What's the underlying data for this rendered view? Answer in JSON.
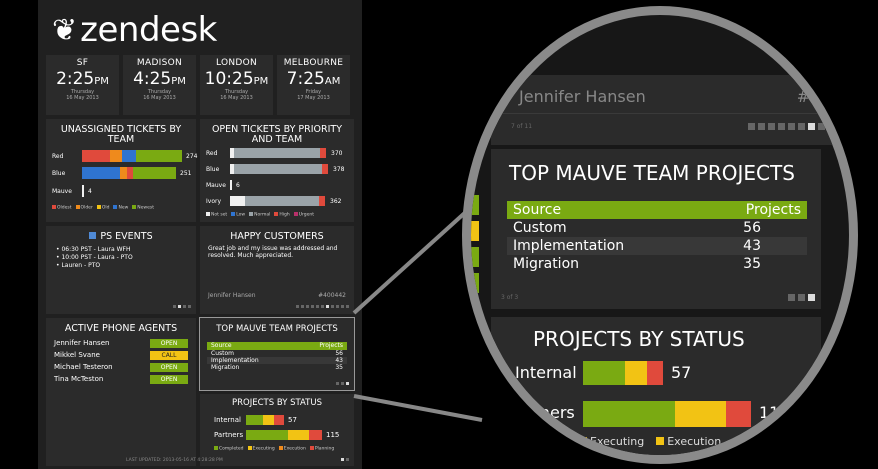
{
  "brand": {
    "name": "zendesk"
  },
  "clocks": [
    {
      "city": "SF",
      "time": "2:25",
      "ampm": "PM",
      "day": "Thursday",
      "date": "16 May 2013"
    },
    {
      "city": "MADISON",
      "time": "4:25",
      "ampm": "PM",
      "day": "Thursday",
      "date": "16 May 2013"
    },
    {
      "city": "LONDON",
      "time": "10:25",
      "ampm": "PM",
      "day": "Thursday",
      "date": "16 May 2013"
    },
    {
      "city": "MELBOURNE",
      "time": "7:25",
      "ampm": "AM",
      "day": "Friday",
      "date": "17 May 2013"
    }
  ],
  "unassigned": {
    "title": "UNASSIGNED TICKETS BY TEAM",
    "rows": [
      {
        "label": "Red",
        "value": "274"
      },
      {
        "label": "Blue",
        "value": "251"
      },
      {
        "label": "Mauve",
        "value": "4"
      }
    ],
    "legend": [
      "Oldest",
      "Older",
      "Old",
      "New",
      "Newest"
    ]
  },
  "open_priority": {
    "title": "OPEN TICKETS BY PRIORITY AND TEAM",
    "rows": [
      {
        "label": "Red",
        "value": "370"
      },
      {
        "label": "Blue",
        "value": "378"
      },
      {
        "label": "Mauve",
        "value": "6"
      },
      {
        "label": "Ivory",
        "value": "362"
      }
    ],
    "legend": [
      "Not set",
      "Low",
      "Normal",
      "High",
      "Urgent"
    ]
  },
  "ps_events": {
    "title": "PS EVENTS",
    "items": [
      "06:30 PST - Laura WFH",
      "10:00 PST - Laura - PTO",
      "Lauren - PTO"
    ]
  },
  "happy": {
    "title": "HAPPY CUSTOMERS",
    "quote": "Great job and my issue was addressed and resolved. Much appreciated.",
    "customer": "Jennifer Hansen",
    "ticket": "#400442"
  },
  "phone_agents": {
    "title": "ACTIVE PHONE AGENTS",
    "agents": [
      {
        "name": "Jennifer Hansen",
        "status": "OPEN"
      },
      {
        "name": "Mikkel Svane",
        "status": "CALL"
      },
      {
        "name": "Michael Testeron",
        "status": "OPEN"
      },
      {
        "name": "Tina McTeston",
        "status": "OPEN"
      }
    ],
    "updated": "LAST UPDATED: 2013-05-16 AT 4:28:28 PM"
  },
  "mauve_projects": {
    "title": "TOP MAUVE TEAM PROJECTS",
    "headers": [
      "Source",
      "Projects"
    ],
    "rows": [
      {
        "source": "Custom",
        "projects": "56"
      },
      {
        "source": "Implementation",
        "projects": "43"
      },
      {
        "source": "Migration",
        "projects": "35"
      }
    ]
  },
  "projects_status": {
    "title": "PROJECTS BY STATUS",
    "rows": [
      {
        "label": "Internal",
        "value": "57"
      },
      {
        "label": "Partners",
        "value": "115"
      }
    ],
    "legend": [
      "Completed",
      "Executing",
      "Execution",
      "Planning"
    ]
  },
  "zoom": {
    "customer": "Jennifer Hansen",
    "ticket": "#40044",
    "pager_text": "7 of 11",
    "pager2_text": "3 of 3",
    "partners_clipped": "rtners",
    "partners_value_clipped": "11",
    "legend": [
      "Executing",
      "Execution"
    ]
  },
  "colors": {
    "green": "#7aaa12",
    "yellow": "#f2c314",
    "red": "#e04a3c",
    "blue": "#2f74d0",
    "orange": "#ef8a1c",
    "gray": "#9aa3a8",
    "white": "#f0f0f0",
    "bg": "#202020",
    "tile": "#2b2b2b"
  }
}
